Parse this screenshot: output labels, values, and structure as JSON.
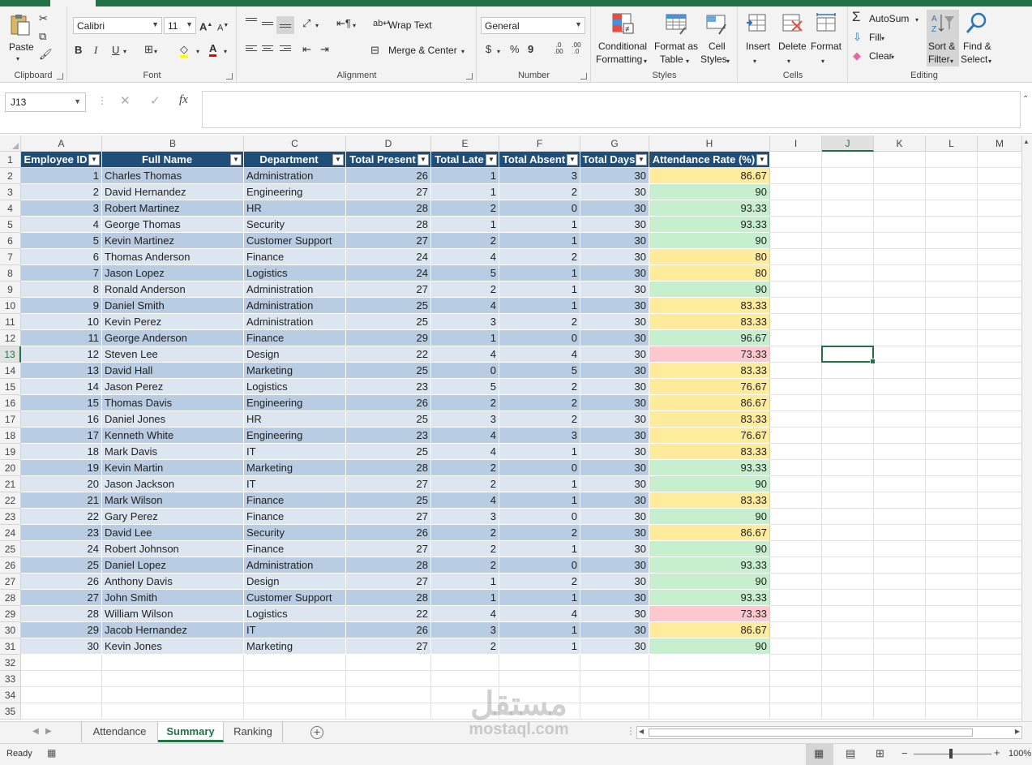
{
  "ribbon": {
    "clipboard": {
      "label": "Clipboard",
      "paste": "Paste"
    },
    "font": {
      "label": "Font",
      "name": "Calibri",
      "size": "11",
      "bold": "B",
      "italic": "I",
      "underline": "U"
    },
    "alignment": {
      "label": "Alignment",
      "wrap_text": "Wrap Text",
      "merge_center": "Merge & Center"
    },
    "number": {
      "label": "Number",
      "format": "General",
      "currency": "$",
      "percent": "%",
      "comma": "9",
      "inc_dec": ".0 .00",
      "dec_dec": ".00 .0"
    },
    "styles": {
      "label": "Styles",
      "conditional_1": "Conditional",
      "conditional_2": "Formatting",
      "format_table_1": "Format as",
      "format_table_2": "Table",
      "cell_styles_1": "Cell",
      "cell_styles_2": "Styles"
    },
    "cells": {
      "label": "Cells",
      "insert": "Insert",
      "delete": "Delete",
      "format": "Format"
    },
    "editing": {
      "label": "Editing",
      "autosum": "AutoSum",
      "fill": "Fill",
      "clear": "Clear",
      "sort_1": "Sort &",
      "sort_2": "Filter",
      "find_1": "Find &",
      "find_2": "Select"
    }
  },
  "formula_bar": {
    "name_box": "J13",
    "formula": "",
    "fx": "fx"
  },
  "columns": [
    "A",
    "B",
    "C",
    "D",
    "E",
    "F",
    "G",
    "H",
    "I",
    "J",
    "K",
    "L",
    "M"
  ],
  "selected_column": "J",
  "selected_row": 13,
  "table_headers": [
    "Employee ID",
    "Full Name",
    "Department",
    "Total Present",
    "Total Late",
    "Total Absent",
    "Total Days",
    "Attendance Rate (%)"
  ],
  "rows": [
    [
      1,
      "Charles Thomas",
      "Administration",
      26,
      1,
      3,
      30,
      "86.67"
    ],
    [
      2,
      "David Hernandez",
      "Engineering",
      27,
      1,
      2,
      30,
      "90"
    ],
    [
      3,
      "Robert Martinez",
      "HR",
      28,
      2,
      0,
      30,
      "93.33"
    ],
    [
      4,
      "George Thomas",
      "Security",
      28,
      1,
      1,
      30,
      "93.33"
    ],
    [
      5,
      "Kevin Martinez",
      "Customer Support",
      27,
      2,
      1,
      30,
      "90"
    ],
    [
      6,
      "Thomas Anderson",
      "Finance",
      24,
      4,
      2,
      30,
      "80"
    ],
    [
      7,
      "Jason Lopez",
      "Logistics",
      24,
      5,
      1,
      30,
      "80"
    ],
    [
      8,
      "Ronald Anderson",
      "Administration",
      27,
      2,
      1,
      30,
      "90"
    ],
    [
      9,
      "Daniel Smith",
      "Administration",
      25,
      4,
      1,
      30,
      "83.33"
    ],
    [
      10,
      "Kevin Perez",
      "Administration",
      25,
      3,
      2,
      30,
      "83.33"
    ],
    [
      11,
      "George Anderson",
      "Finance",
      29,
      1,
      0,
      30,
      "96.67"
    ],
    [
      12,
      "Steven Lee",
      "Design",
      22,
      4,
      4,
      30,
      "73.33"
    ],
    [
      13,
      "David Hall",
      "Marketing",
      25,
      0,
      5,
      30,
      "83.33"
    ],
    [
      14,
      "Jason Perez",
      "Logistics",
      23,
      5,
      2,
      30,
      "76.67"
    ],
    [
      15,
      "Thomas Davis",
      "Engineering",
      26,
      2,
      2,
      30,
      "86.67"
    ],
    [
      16,
      "Daniel Jones",
      "HR",
      25,
      3,
      2,
      30,
      "83.33"
    ],
    [
      17,
      "Kenneth White",
      "Engineering",
      23,
      4,
      3,
      30,
      "76.67"
    ],
    [
      18,
      "Mark Davis",
      "IT",
      25,
      4,
      1,
      30,
      "83.33"
    ],
    [
      19,
      "Kevin Martin",
      "Marketing",
      28,
      2,
      0,
      30,
      "93.33"
    ],
    [
      20,
      "Jason Jackson",
      "IT",
      27,
      2,
      1,
      30,
      "90"
    ],
    [
      21,
      "Mark Wilson",
      "Finance",
      25,
      4,
      1,
      30,
      "83.33"
    ],
    [
      22,
      "Gary Perez",
      "Finance",
      27,
      3,
      0,
      30,
      "90"
    ],
    [
      23,
      "David Lee",
      "Security",
      26,
      2,
      2,
      30,
      "86.67"
    ],
    [
      24,
      "Robert Johnson",
      "Finance",
      27,
      2,
      1,
      30,
      "90"
    ],
    [
      25,
      "Daniel Lopez",
      "Administration",
      28,
      2,
      0,
      30,
      "93.33"
    ],
    [
      26,
      "Anthony Davis",
      "Design",
      27,
      1,
      2,
      30,
      "90"
    ],
    [
      27,
      "John Smith",
      "Customer Support",
      28,
      1,
      1,
      30,
      "93.33"
    ],
    [
      28,
      "William Wilson",
      "Logistics",
      22,
      4,
      4,
      30,
      "73.33"
    ],
    [
      29,
      "Jacob Hernandez",
      "IT",
      26,
      3,
      1,
      30,
      "86.67"
    ],
    [
      30,
      "Kevin Jones",
      "Marketing",
      27,
      2,
      1,
      30,
      "90"
    ]
  ],
  "row_count": 35,
  "colors": {
    "accent": "#217346",
    "header_fill": "#1f4e79",
    "band_dark": "#b8cce4",
    "band_light": "#dce6f1",
    "rate_green": "#c6efce",
    "rate_yellow": "#ffeb9c",
    "rate_red": "#ffc7ce"
  },
  "sheet_tabs": [
    {
      "label": "Attendance",
      "active": false
    },
    {
      "label": "Summary",
      "active": true
    },
    {
      "label": "Ranking",
      "active": false
    }
  ],
  "status": {
    "ready": "Ready",
    "zoom": "100%"
  },
  "watermark": {
    "arabic": "مستقل",
    "latin": "mostaql.com"
  }
}
